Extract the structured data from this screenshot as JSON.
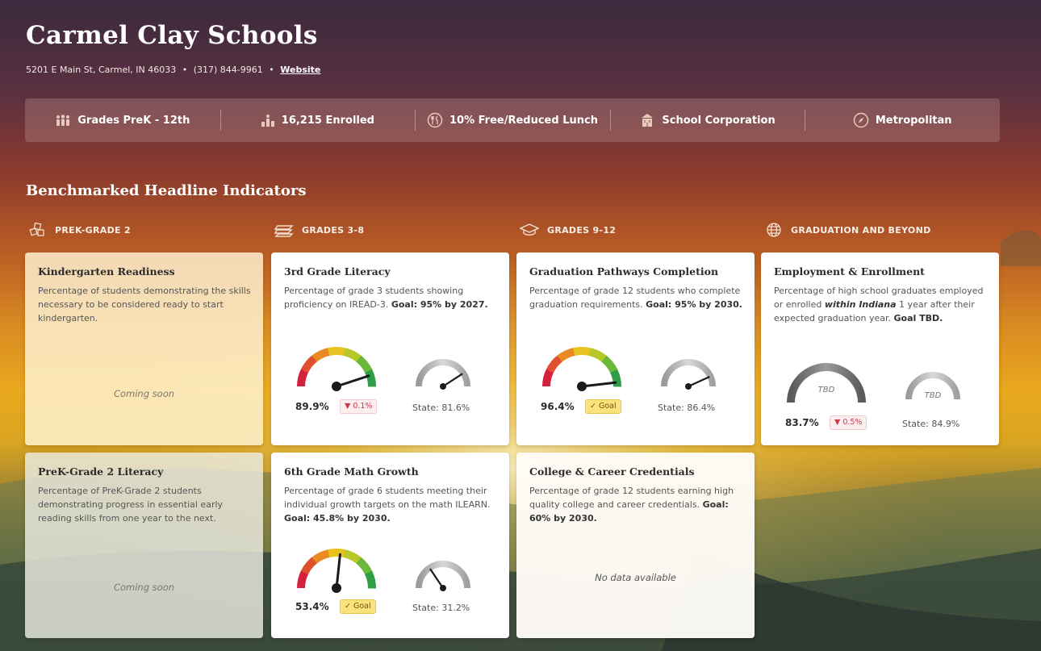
{
  "school": {
    "name": "Carmel Clay Schools",
    "address": "5201 E Main St, Carmel, IN 46033",
    "separator": "•",
    "phone": "(317) 844-9961",
    "website_label": "Website"
  },
  "stats": [
    {
      "icon": "people-icon",
      "label": "Grades PreK - 12th"
    },
    {
      "icon": "enrolled-icon",
      "label": "16,215 Enrolled"
    },
    {
      "icon": "lunch-icon",
      "label": "10% Free/Reduced Lunch"
    },
    {
      "icon": "building-icon",
      "label": "School Corporation"
    },
    {
      "icon": "compass-icon",
      "label": "Metropolitan"
    }
  ],
  "section_title": "Benchmarked Headline Indicators",
  "columns": [
    {
      "icon": "blocks-icon",
      "label": "PREK-GRADE 2"
    },
    {
      "icon": "books-icon",
      "label": "GRADES 3-8"
    },
    {
      "icon": "graduation-cap-icon",
      "label": "GRADES 9-12"
    },
    {
      "icon": "globe-icon",
      "label": "GRADUATION AND BEYOND"
    }
  ],
  "cards": {
    "kindergarten": {
      "title": "Kindergarten Readiness",
      "description": "Percentage of students demonstrating the skills necessary to be considered ready to start kindergarten.",
      "status": "Coming soon"
    },
    "literacy3": {
      "title": "3rd Grade Literacy",
      "description": "Percentage of grade 3 students showing proficiency on IREAD-3.",
      "goal": "Goal: 95% by 2027.",
      "value": "89.9%",
      "change": "▼ 0.1%",
      "state": "State: 81.6%",
      "gauge_level": 0.899,
      "state_level": 0.816
    },
    "gradpath": {
      "title": "Graduation Pathways Completion",
      "description": "Percentage of grade 12 students who complete graduation requirements.",
      "goal": "Goal: 95% by 2030.",
      "value": "96.4%",
      "badge": "✓ Goal",
      "state": "State: 86.4%",
      "gauge_level": 0.964,
      "state_level": 0.864
    },
    "employment": {
      "title": "Employment & Enrollment",
      "description_pre": "Percentage of high school graduates employed or enrolled ",
      "description_em": "within Indiana",
      "description_post": " 1 year after their expected graduation year.",
      "goal": "Goal TBD.",
      "gauge_text": "TBD",
      "state_gauge_text": "TBD",
      "value": "83.7%",
      "change": "▼ 0.5%",
      "state": "State: 84.9%"
    },
    "prek_literacy": {
      "title": "PreK-Grade 2 Literacy",
      "description": "Percentage of PreK-Grade 2 students demonstrating progress in essential early reading skills from one year to the next.",
      "status": "Coming soon"
    },
    "math6": {
      "title": "6th Grade Math Growth",
      "description": "Percentage of grade 6 students meeting their individual growth targets on the math ILEARN.",
      "goal": "Goal: 45.8% by 2030.",
      "value": "53.4%",
      "badge": "✓ Goal",
      "state": "State: 31.2%",
      "gauge_level": 0.534,
      "state_level": 0.312
    },
    "credentials": {
      "title": "College & Career Credentials",
      "description": "Percentage of grade 12 students earning high quality college and career credentials.",
      "goal": "Goal: 60% by 2030.",
      "status": "No data available"
    }
  }
}
